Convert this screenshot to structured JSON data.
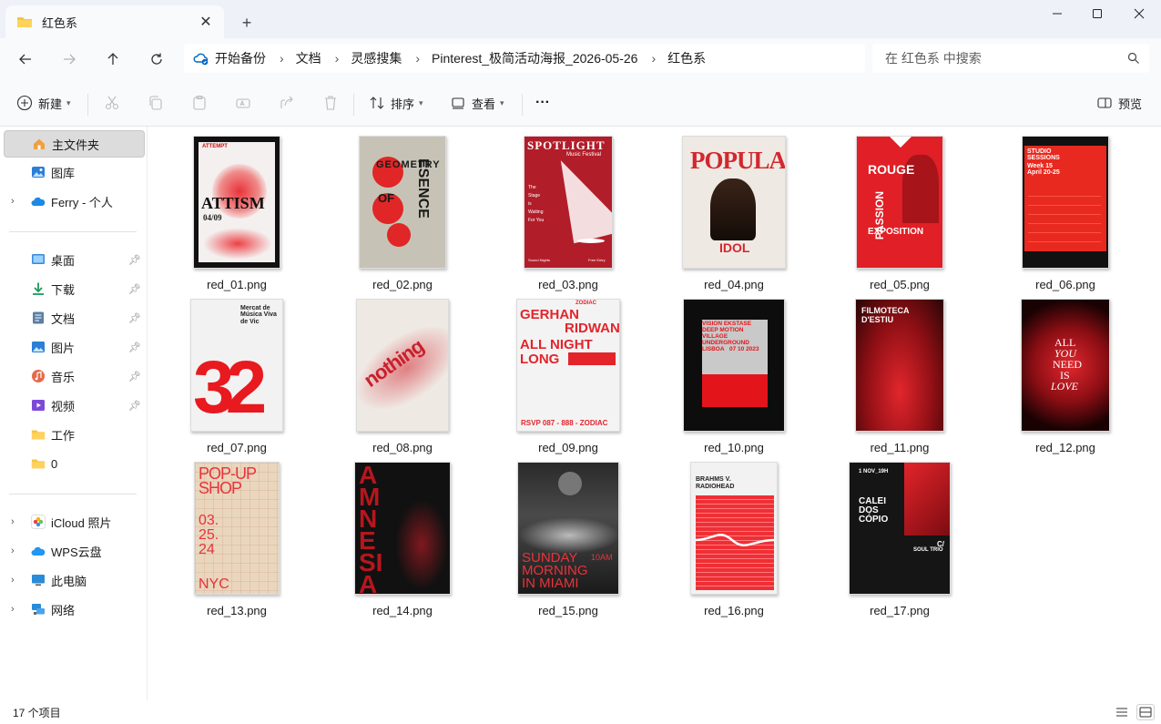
{
  "window": {
    "tab_title": "红色系",
    "new_tab": "+",
    "close_tab": "✕"
  },
  "nav": {
    "breadcrumb": [
      "开始备份",
      "文档",
      "灵感搜集",
      "Pinterest_极简活动海报_2026-05-26",
      "红色系"
    ],
    "search_placeholder": "在 红色系 中搜索"
  },
  "toolbar": {
    "new_label": "新建",
    "sort_label": "排序",
    "view_label": "查看",
    "more_label": "···",
    "preview_label": "预览"
  },
  "sidebar": {
    "items": [
      {
        "label": "主文件夹",
        "icon": "home-icon"
      },
      {
        "label": "图库",
        "icon": "gallery-icon"
      },
      {
        "label": "Ferry - 个人",
        "icon": "onedrive-cloud-icon"
      },
      {
        "label": "桌面",
        "icon": "desktop-icon"
      },
      {
        "label": "下载",
        "icon": "download-icon"
      },
      {
        "label": "文档",
        "icon": "document-icon"
      },
      {
        "label": "图片",
        "icon": "pictures-icon"
      },
      {
        "label": "音乐",
        "icon": "music-icon"
      },
      {
        "label": "视频",
        "icon": "video-icon"
      },
      {
        "label": "工作",
        "icon": "folder-icon"
      },
      {
        "label": "0",
        "icon": "folder-icon"
      },
      {
        "label": "iCloud 照片",
        "icon": "icloud-photos-icon"
      },
      {
        "label": "WPS云盘",
        "icon": "wps-cloud-icon"
      },
      {
        "label": "此电脑",
        "icon": "computer-icon"
      },
      {
        "label": "网络",
        "icon": "network-icon"
      }
    ]
  },
  "files": [
    {
      "name": "red_01.png",
      "text": [
        "ATTEMPT",
        "ATTISM",
        "04/09"
      ]
    },
    {
      "name": "red_02.png",
      "text": [
        "GEOMETRY",
        "OF",
        "ESENCE"
      ]
    },
    {
      "name": "red_03.png",
      "text": [
        "SPOTLIGHT",
        "Music Festival",
        "The Stage is Waiting For You",
        "Sound Nights",
        "Free Entry"
      ]
    },
    {
      "name": "red_04.png",
      "text": [
        "POPULAR",
        "IDOL"
      ]
    },
    {
      "name": "red_05.png",
      "text": [
        "ROUGE",
        "PASSION",
        "EXPOSITION"
      ]
    },
    {
      "name": "red_06.png",
      "text": [
        "STUDIO SESSIONS",
        "Week 15",
        "April 20-25"
      ]
    },
    {
      "name": "red_07.png",
      "text": [
        "Mercat de Música Viva de Vic",
        "32"
      ]
    },
    {
      "name": "red_08.png",
      "text": [
        "nothing"
      ]
    },
    {
      "name": "red_09.png",
      "text": [
        "ZODIAC",
        "GERHAN",
        "RIDWAN",
        "ALL NIGHT",
        "LONG",
        "RSVP 087 - 888 - ZODIAC"
      ]
    },
    {
      "name": "red_10.png",
      "text": [
        "VISION EKSTASE",
        "DEEP MOTION",
        "VILLAGE",
        "UNDERGROUND",
        "LISBOA",
        "07 10 2023"
      ]
    },
    {
      "name": "red_11.png",
      "text": [
        "FILMOTECA",
        "D'ESTIU"
      ]
    },
    {
      "name": "red_12.png",
      "text": [
        "ALL",
        "YOU",
        "NEED",
        "IS",
        "LOVE"
      ]
    },
    {
      "name": "red_13.png",
      "text": [
        "POP-UP",
        "SHOP",
        "03.",
        "25.",
        "24",
        "NYC"
      ]
    },
    {
      "name": "red_14.png",
      "text": [
        "AMNESIA"
      ]
    },
    {
      "name": "red_15.png",
      "text": [
        "SUNDAY",
        "MORNING",
        "IN MIAMI",
        "10AM"
      ]
    },
    {
      "name": "red_16.png",
      "text": [
        "BRAHMS V.",
        "RADIOHEAD"
      ]
    },
    {
      "name": "red_17.png",
      "text": [
        "1 NOV_19H",
        "CALEI",
        "DOS",
        "CÓPIO",
        "C/",
        "SOUL TRIO"
      ]
    }
  ],
  "status": {
    "count": "17 个项目"
  },
  "colors": {
    "accent": "#0067c0",
    "poster_red": "#e32b2b",
    "folder_yellow": "#f5c542"
  }
}
